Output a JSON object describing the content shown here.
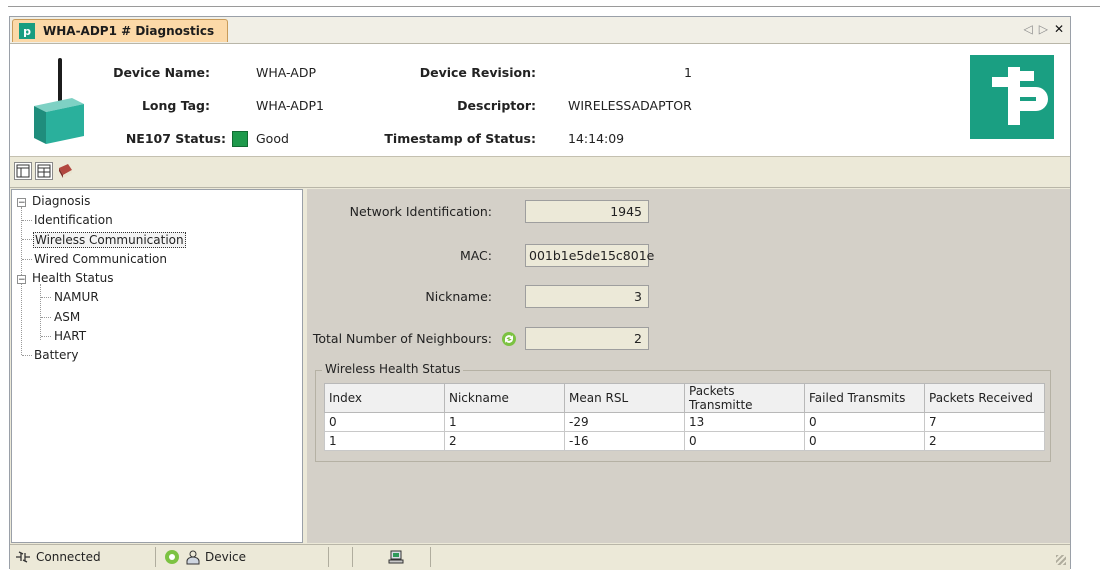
{
  "tab": {
    "title": "WHA-ADP1 # Diagnostics",
    "logo_text": "p"
  },
  "nav": {
    "left": "◁",
    "right": "▷",
    "close": "✕"
  },
  "device": {
    "name_label": "Device Name:",
    "name_value": "WHA-ADP",
    "longtag_label": "Long Tag:",
    "longtag_value": "WHA-ADP1",
    "ne107_label": "NE107 Status:",
    "ne107_value": "Good",
    "revision_label": "Device Revision:",
    "revision_value": "1",
    "descriptor_label": "Descriptor:",
    "descriptor_value": "WIRELESSADAPTOR",
    "timestamp_label": "Timestamp of Status:",
    "timestamp_value": "14:14:09"
  },
  "colors": {
    "status_good": "#1e9a4c",
    "brand": "#1a9f82"
  },
  "tree": {
    "root": "Diagnosis",
    "identification": "Identification",
    "wireless": "Wireless Communication",
    "wired": "Wired Communication",
    "health": "Health Status",
    "namur": "NAMUR",
    "asm": "ASM",
    "hart": "HART",
    "battery": "Battery",
    "collapse_glyph": "−"
  },
  "form": {
    "network_id_label": "Network Identification:",
    "network_id_value": "1945",
    "mac_label": "MAC:",
    "mac_value": "001b1e5de15c801e",
    "nickname_label": "Nickname:",
    "nickname_value": "3",
    "neighbours_label": "Total Number of Neighbours:",
    "neighbours_value": "2"
  },
  "health_group": {
    "title": "Wireless Health Status",
    "columns": [
      "Index",
      "Nickname",
      "Mean RSL",
      "Packets Transmitte",
      "Failed Transmits",
      "Packets Received"
    ],
    "rows": [
      [
        "0",
        "1",
        "-29",
        "13",
        "0",
        "7"
      ],
      [
        "1",
        "2",
        "-16",
        "0",
        "0",
        "2"
      ]
    ]
  },
  "statusbar": {
    "connection": "Connected",
    "device": "Device"
  }
}
